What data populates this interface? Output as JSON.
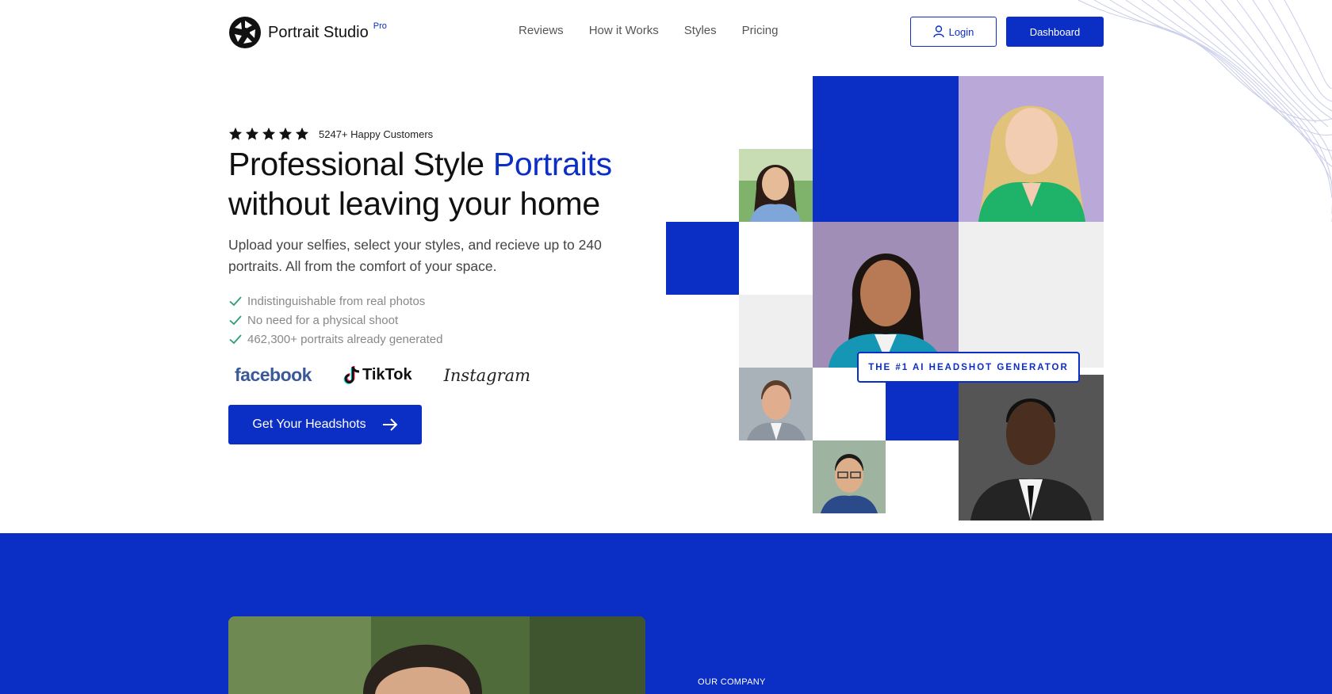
{
  "brand": {
    "name": "Portrait Studio",
    "tier": "Pro"
  },
  "nav": {
    "items": [
      "Reviews",
      "How it Works",
      "Styles",
      "Pricing"
    ]
  },
  "header": {
    "login_label": "Login",
    "dashboard_label": "Dashboard"
  },
  "hero": {
    "rating": 5,
    "customers": "5247+ Happy Customers",
    "headline_part1": "Professional Style ",
    "headline_accent": "Portraits",
    "headline_line2": "without leaving your home",
    "subtitle": "Upload your selfies, select your styles, and recieve up to 240 portraits. All from the comfort of your space.",
    "features": [
      "Indistinguishable from real photos",
      "No need for a physical shoot",
      "462,300+ portraits already generated"
    ],
    "socials": {
      "facebook": "facebook",
      "tiktok": "TikTok",
      "instagram": "Instagram"
    },
    "cta_label": "Get Your Headshots"
  },
  "collage": {
    "badge": "THE #1 AI HEADSHOT GENERATOR"
  },
  "company": {
    "label": "OUR COMPANY"
  },
  "colors": {
    "accent": "#0b2ec4",
    "check": "#2a9d7a",
    "muted": "#888888"
  }
}
